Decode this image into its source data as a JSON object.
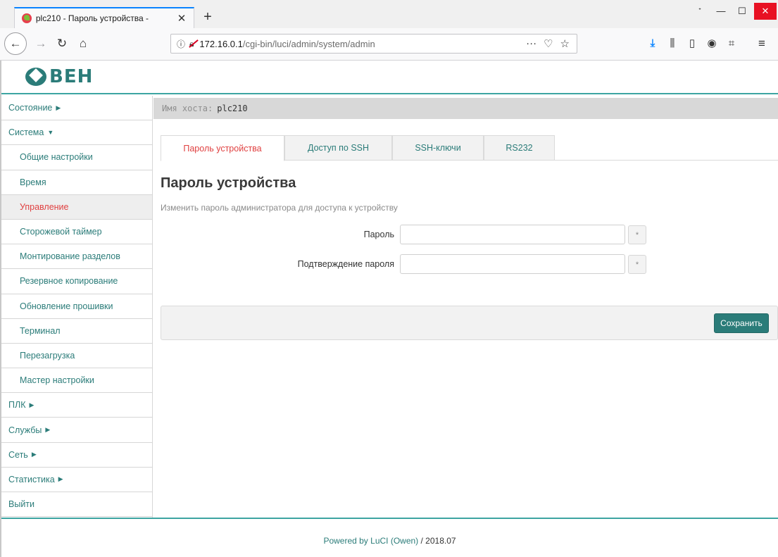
{
  "browser": {
    "tab_title": "plc210 - Пароль устройства - ",
    "tab_close": "✕",
    "new_tab": "+",
    "url_host": "172.16.0.1",
    "url_path": "/cgi-bin/luci/admin/system/admin",
    "window_buttons": {
      "system": "ᐩ",
      "minimize": "—",
      "maximize": "☐",
      "close": "✕"
    }
  },
  "icons": {
    "back": "back-arrow-icon",
    "forward": "forward-arrow-icon",
    "reload": "reload-icon",
    "home": "home-icon",
    "info": "info-icon",
    "insecure": "insecure-lock-icon",
    "more": "more-icon",
    "pocket": "pocket-icon",
    "bookmark": "star-icon",
    "download": "download-icon",
    "library": "library-icon",
    "sidebar": "sidebar-icon",
    "account": "account-icon",
    "extension": "screenshot-icon",
    "menu": "hamburger-menu-icon"
  },
  "brand": {
    "logo_text": "ВЕН"
  },
  "nav": {
    "items": [
      {
        "label": "Состояние",
        "caret": "▶"
      },
      {
        "label": "Система",
        "caret": "▼"
      },
      {
        "label": "Общие настройки"
      },
      {
        "label": "Время"
      },
      {
        "label": "Управление"
      },
      {
        "label": "Сторожевой таймер"
      },
      {
        "label": "Монтирование разделов"
      },
      {
        "label": "Резервное копирование"
      },
      {
        "label": "Обновление прошивки"
      },
      {
        "label": "Терминал"
      },
      {
        "label": "Перезагрузка"
      },
      {
        "label": "Мастер настройки"
      },
      {
        "label": "ПЛК",
        "caret": "▶"
      },
      {
        "label": "Службы",
        "caret": "▶"
      },
      {
        "label": "Сеть",
        "caret": "▶"
      },
      {
        "label": "Статистика",
        "caret": "▶"
      },
      {
        "label": "Выйти"
      }
    ]
  },
  "hostbar": {
    "label": "Имя хоста:",
    "value": "plc210"
  },
  "tabs": [
    {
      "label": "Пароль устройства",
      "active": true
    },
    {
      "label": "Доступ по SSH"
    },
    {
      "label": "SSH-ключи"
    },
    {
      "label": "RS232"
    }
  ],
  "section": {
    "title": "Пароль устройства",
    "description": "Изменить пароль администратора для доступа к устройству"
  },
  "form": {
    "password_label": "Пароль",
    "password_value": "",
    "confirm_label": "Подтверждение пароля",
    "confirm_value": "",
    "reveal_glyph": "*"
  },
  "actions": {
    "save_label": "Сохранить"
  },
  "footer": {
    "powered": "Powered by LuCI (Owen)",
    "version": " / 2018.07"
  },
  "colors": {
    "accent": "#2b7c79",
    "active_link": "#e04141",
    "divider": "#3da5a2"
  }
}
